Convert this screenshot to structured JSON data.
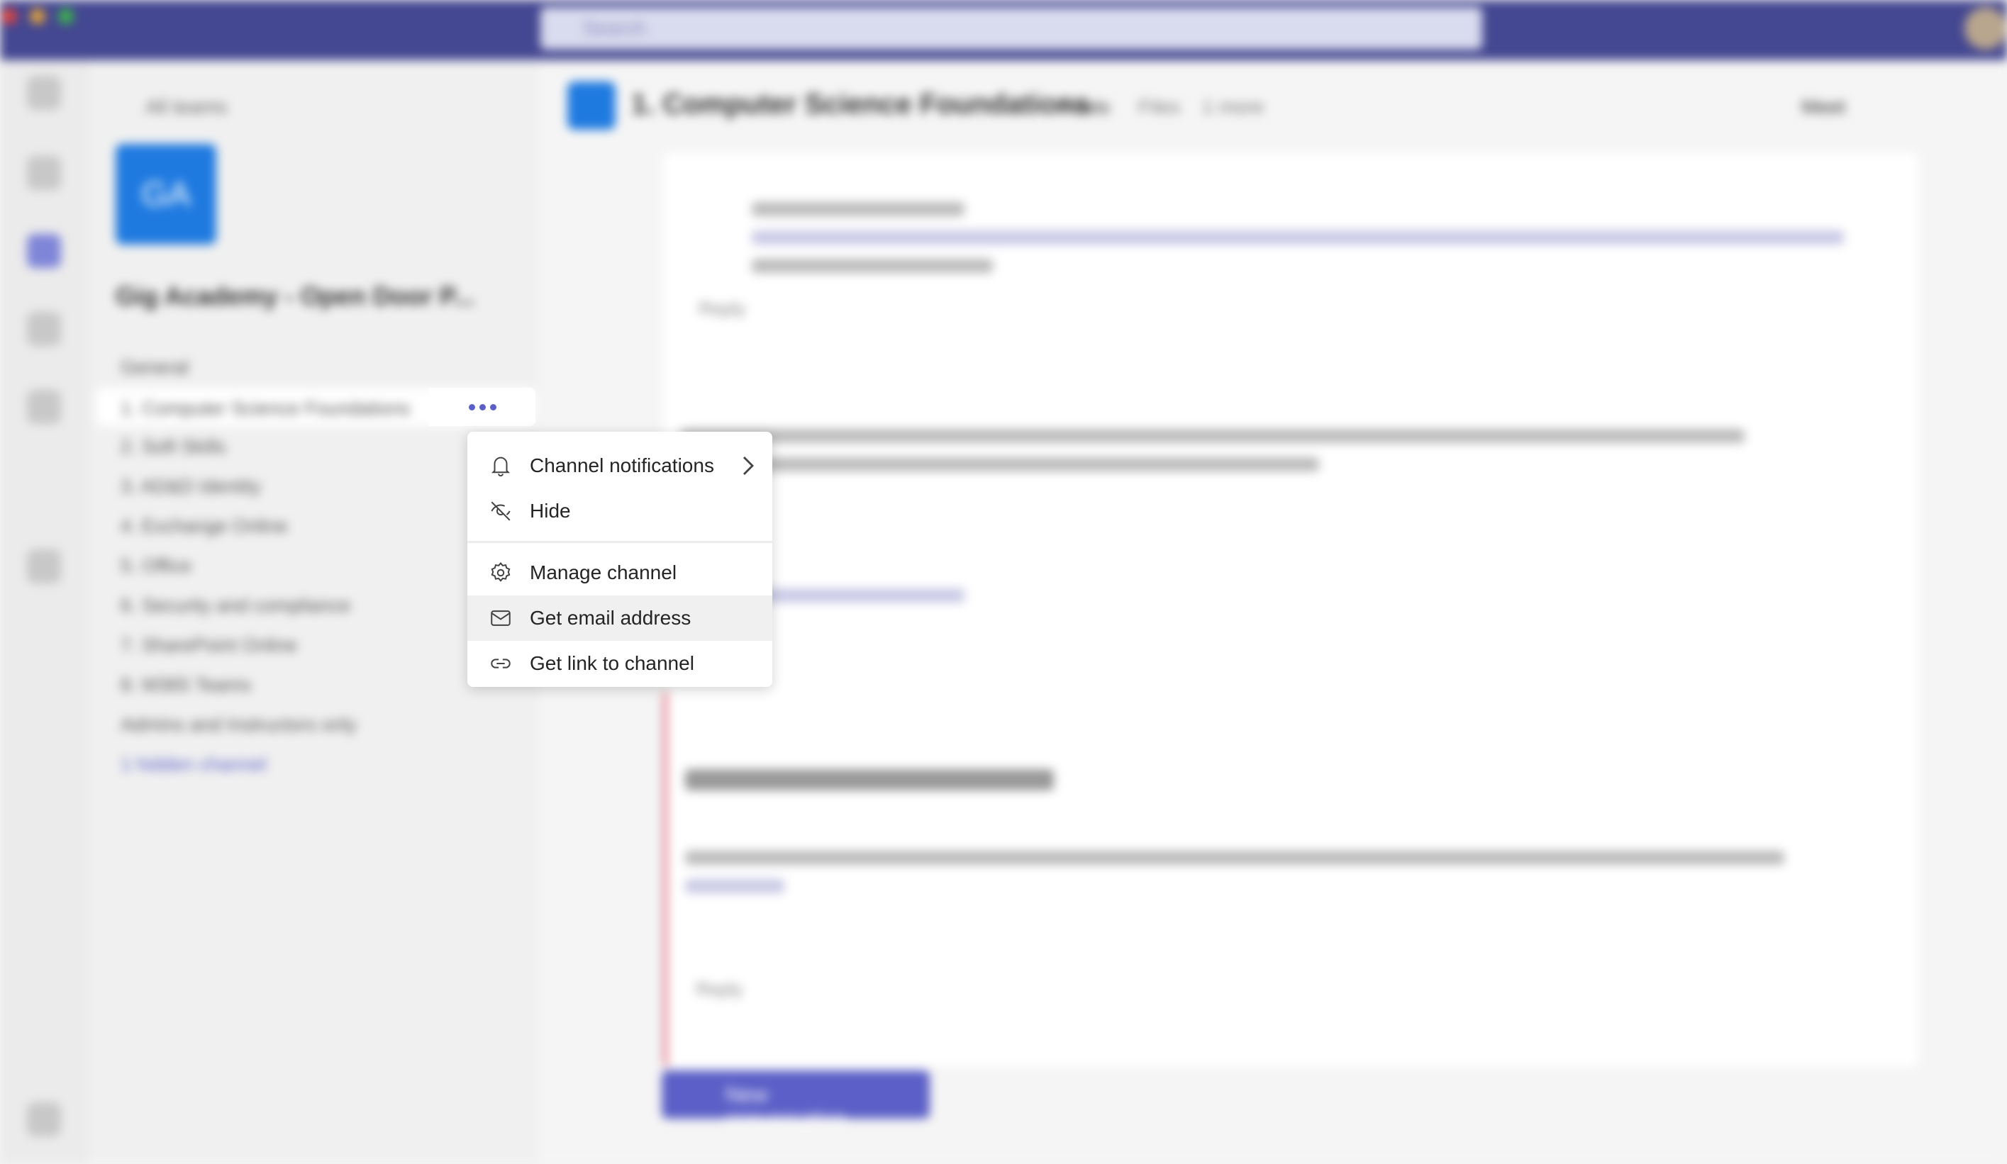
{
  "topbar": {
    "search_placeholder": "Search"
  },
  "sidebar": {
    "back_label": "All teams",
    "team_initials": "GA",
    "team_name": "Gig Academy - Open Door P...",
    "channels": [
      "General",
      "1. Computer Science Foundations",
      "2. Soft Skills",
      "3. AD&D Identity",
      "4. Exchange Online",
      "5. Office",
      "6. Security and compliance",
      "7. SharePoint Online",
      "8. M365 Teams",
      "Admins and Instructors only",
      "1 hidden channel"
    ],
    "selected_index": 1
  },
  "main": {
    "channel_title": "1. Computer Science Foundations",
    "tabs": [
      "Posts",
      "Files",
      "1 more"
    ],
    "meet_label": "Meet",
    "reply_label": "Reply",
    "new_conversation_label": "New conversation",
    "accent_color": "#5b5fc7"
  },
  "context_menu": {
    "items": [
      {
        "label": "Channel notifications",
        "icon": "bell-icon",
        "submenu": true
      },
      {
        "label": "Hide",
        "icon": "eye-off-icon"
      },
      {
        "label": "Manage channel",
        "icon": "gear-icon"
      },
      {
        "label": "Get email address",
        "icon": "mail-icon",
        "highlighted": true
      },
      {
        "label": "Get link to channel",
        "icon": "link-icon"
      }
    ]
  }
}
